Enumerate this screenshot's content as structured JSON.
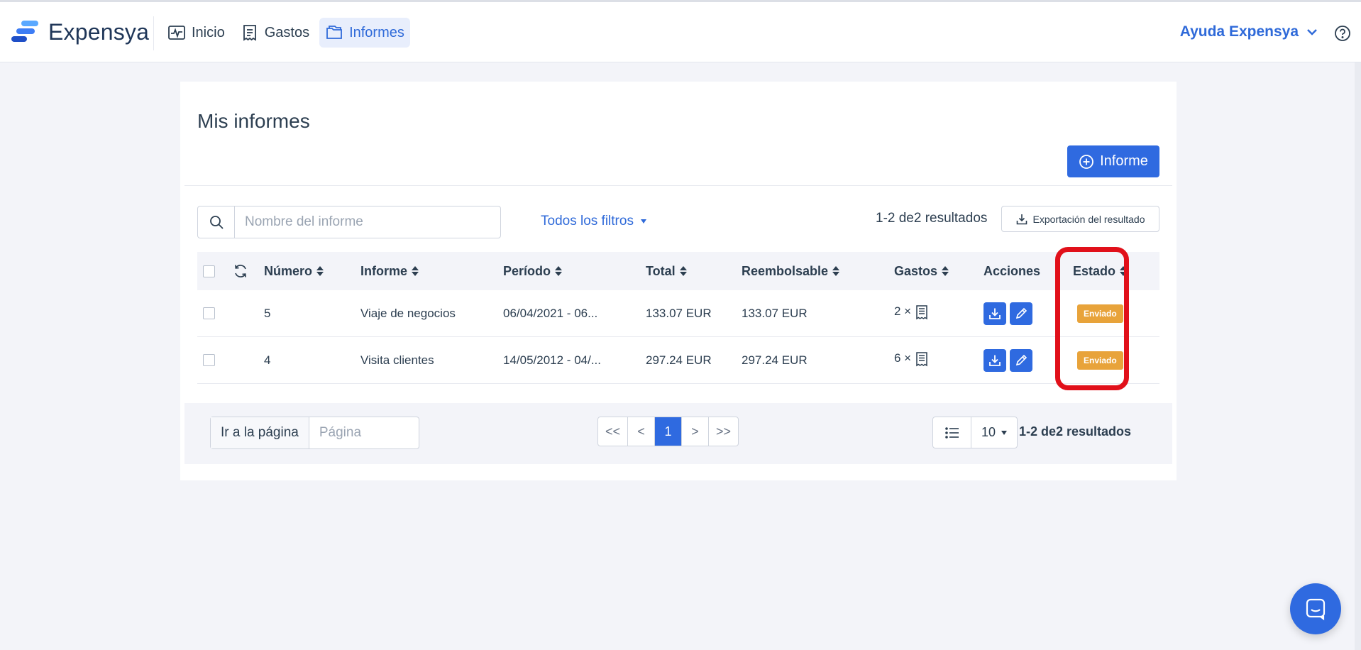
{
  "app": {
    "brand": "Expensya"
  },
  "nav": {
    "items": [
      {
        "label": "Inicio",
        "icon": "activity-chart-icon",
        "active": false
      },
      {
        "label": "Gastos",
        "icon": "receipt-icon",
        "active": false
      },
      {
        "label": "Informes",
        "icon": "folder-icon",
        "active": true
      }
    ]
  },
  "help": {
    "label": "Ayuda Expensya"
  },
  "page": {
    "title": "Mis informes",
    "new_button_label": "Informe"
  },
  "filters": {
    "search_placeholder": "Nombre del informe",
    "all_filters_label": "Todos los filtros",
    "results_summary": "1-2 de2 resultados",
    "export_label": "Exportación del resultado"
  },
  "table": {
    "columns": [
      "Número",
      "Informe",
      "Período",
      "Total",
      "Reembolsable",
      "Gastos",
      "Acciones",
      "Estado"
    ],
    "rows": [
      {
        "number": "5",
        "report": "Viaje de negocios",
        "period": "06/04/2021 - 06...",
        "total": "133.07 EUR",
        "refundable": "133.07 EUR",
        "expenses": "2 ×",
        "status": "Enviado"
      },
      {
        "number": "4",
        "report": "Visita clientes",
        "period": "14/05/2012 - 04/...",
        "total": "297.24 EUR",
        "refundable": "297.24 EUR",
        "expenses": "6 ×",
        "status": "Enviado"
      }
    ]
  },
  "pagination": {
    "goto_label": "Ir a la página",
    "page_placeholder": "Página",
    "buttons": [
      "<<",
      "<",
      "1",
      ">",
      ">>"
    ],
    "current_page": "1",
    "per_page": "10",
    "results_summary": "1-2 de2 resultados"
  },
  "colors": {
    "accent": "#2f6ae0",
    "status_sent": "#e8a33a",
    "highlight": "#e1101a"
  }
}
